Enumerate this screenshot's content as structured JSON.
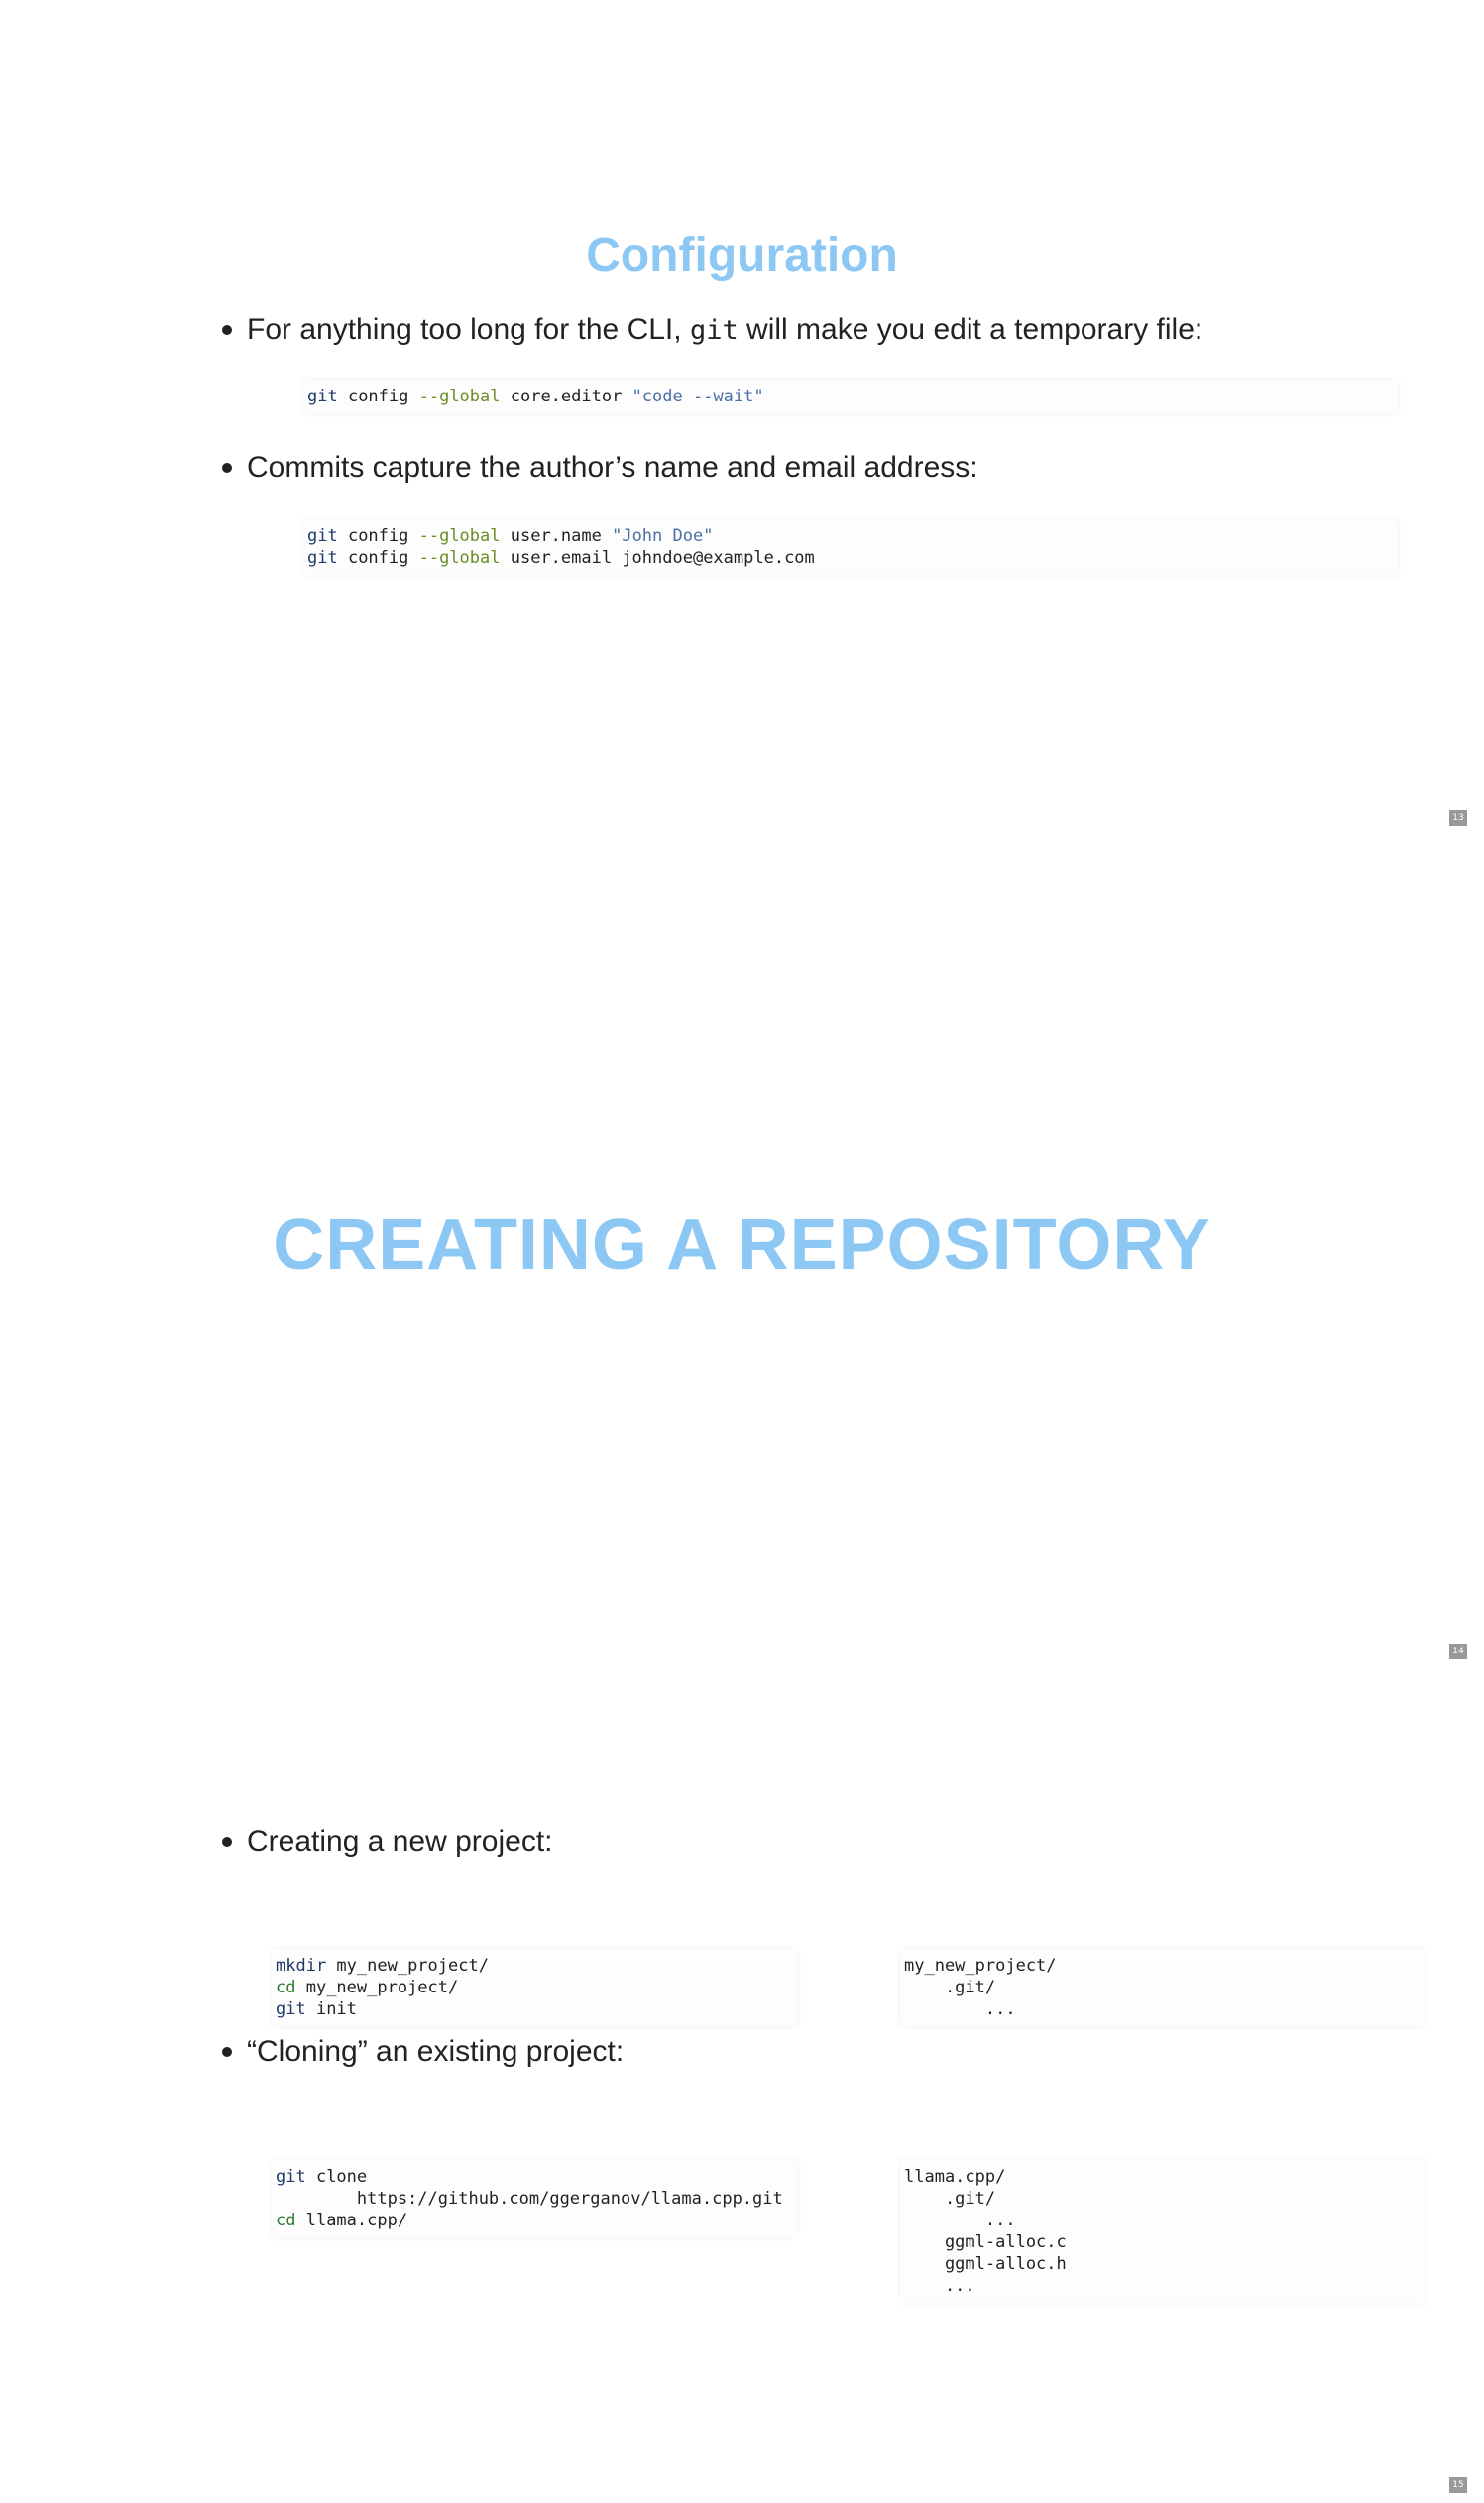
{
  "slides": [
    {
      "title": "Configuration",
      "bullets": [
        {
          "text_before": "For anything too long for the CLI, ",
          "inline_code": "git",
          "text_after": " will make you edit a temporary file:",
          "code": [
            [
              {
                "t": "git",
                "c": "kw"
              },
              {
                "t": " config ",
                "c": ""
              },
              {
                "t": "--global",
                "c": "opt"
              },
              {
                "t": " core.editor ",
                "c": ""
              },
              {
                "t": "\"code --wait\"",
                "c": "str"
              }
            ]
          ]
        },
        {
          "text": "Commits capture the author’s name and email address:",
          "code": [
            [
              {
                "t": "git",
                "c": "kw"
              },
              {
                "t": " config ",
                "c": ""
              },
              {
                "t": "--global",
                "c": "opt"
              },
              {
                "t": " user.name ",
                "c": ""
              },
              {
                "t": "\"John Doe\"",
                "c": "str"
              }
            ],
            [
              {
                "t": "git",
                "c": "kw"
              },
              {
                "t": " config ",
                "c": ""
              },
              {
                "t": "--global",
                "c": "opt"
              },
              {
                "t": " user.email johndoe@example.com",
                "c": ""
              }
            ]
          ]
        }
      ],
      "page_number": "13"
    },
    {
      "section_title": "CREATING A REPOSITORY",
      "page_number": "14"
    },
    {
      "bullets": [
        {
          "text": "Creating a new project:",
          "code_left": [
            [
              {
                "t": "mkdir",
                "c": "kw"
              },
              {
                "t": " my_new_project/",
                "c": ""
              }
            ],
            [
              {
                "t": "cd",
                "c": "kw-green"
              },
              {
                "t": " my_new_project/",
                "c": ""
              }
            ],
            [
              {
                "t": "git",
                "c": "kw"
              },
              {
                "t": " init",
                "c": ""
              }
            ]
          ],
          "code_right": [
            [
              {
                "t": "my_new_project/",
                "c": ""
              }
            ],
            [
              {
                "t": "    .git/",
                "c": ""
              }
            ],
            [
              {
                "t": "        ...",
                "c": ""
              }
            ]
          ]
        },
        {
          "text": "“Cloning” an existing project:",
          "code_left": [
            [
              {
                "t": "git",
                "c": "kw"
              },
              {
                "t": " clone",
                "c": ""
              }
            ],
            [
              {
                "t": "        https://github.com/ggerganov/llama.cpp.git",
                "c": ""
              }
            ],
            [
              {
                "t": "cd",
                "c": "kw-green"
              },
              {
                "t": " llama.cpp/",
                "c": ""
              }
            ]
          ],
          "code_right": [
            [
              {
                "t": "llama.cpp/",
                "c": ""
              }
            ],
            [
              {
                "t": "    .git/",
                "c": ""
              }
            ],
            [
              {
                "t": "        ...",
                "c": ""
              }
            ],
            [
              {
                "t": "    ggml-alloc.c",
                "c": ""
              }
            ],
            [
              {
                "t": "    ggml-alloc.h",
                "c": ""
              }
            ],
            [
              {
                "t": "    ...",
                "c": ""
              }
            ]
          ]
        }
      ],
      "page_number": "15"
    }
  ],
  "colors": {
    "title": "#8cc8f3",
    "text": "#222222",
    "keyword": "#1f3a6b",
    "cd_keyword": "#2f7d2f",
    "option": "#6b8e23",
    "string": "#4a6fa5",
    "page_number_bg": "#999999"
  }
}
